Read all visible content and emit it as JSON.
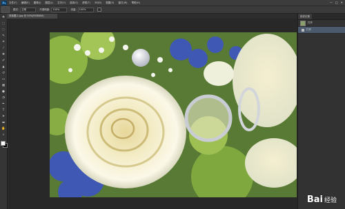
{
  "app": {
    "logo": "Ps"
  },
  "menu": [
    "文件(F)",
    "编辑(E)",
    "图像(I)",
    "图层(L)",
    "文字(Y)",
    "选择(S)",
    "滤镜(T)",
    "3D(D)",
    "视图(V)",
    "窗口(W)",
    "帮助(H)"
  ],
  "window_controls": [
    "—",
    "□",
    "✕"
  ],
  "options_bar": {
    "mode_label": "模式:",
    "mode_value": "正常",
    "opacity_label": "不透明度:",
    "opacity_value": "100%",
    "flow_label": "流量:",
    "flow_value": "100%"
  },
  "document": {
    "tab_title": "未标题-1.jpg @ 50%(RGB/8#)"
  },
  "tools": [
    "move-icon",
    "marquee-icon",
    "lasso-icon",
    "quick-select-icon",
    "crop-icon",
    "eyedropper-icon",
    "healing-icon",
    "brush-icon",
    "stamp-icon",
    "history-brush-icon",
    "eraser-icon",
    "gradient-icon",
    "blur-icon",
    "dodge-icon",
    "pen-icon",
    "type-icon",
    "path-select-icon",
    "shape-icon",
    "hand-icon",
    "zoom-icon"
  ],
  "history_panel": {
    "tab_label": "历史记录",
    "items": [
      {
        "label": "打开",
        "selected": false
      },
      {
        "label": "打开",
        "selected": true
      }
    ]
  },
  "watermark": {
    "brand": "Bai",
    "sub": "经验"
  },
  "colors": {
    "accent": "#4b5a6d",
    "chrome": "#3c3c3c",
    "workspace": "#282828"
  }
}
